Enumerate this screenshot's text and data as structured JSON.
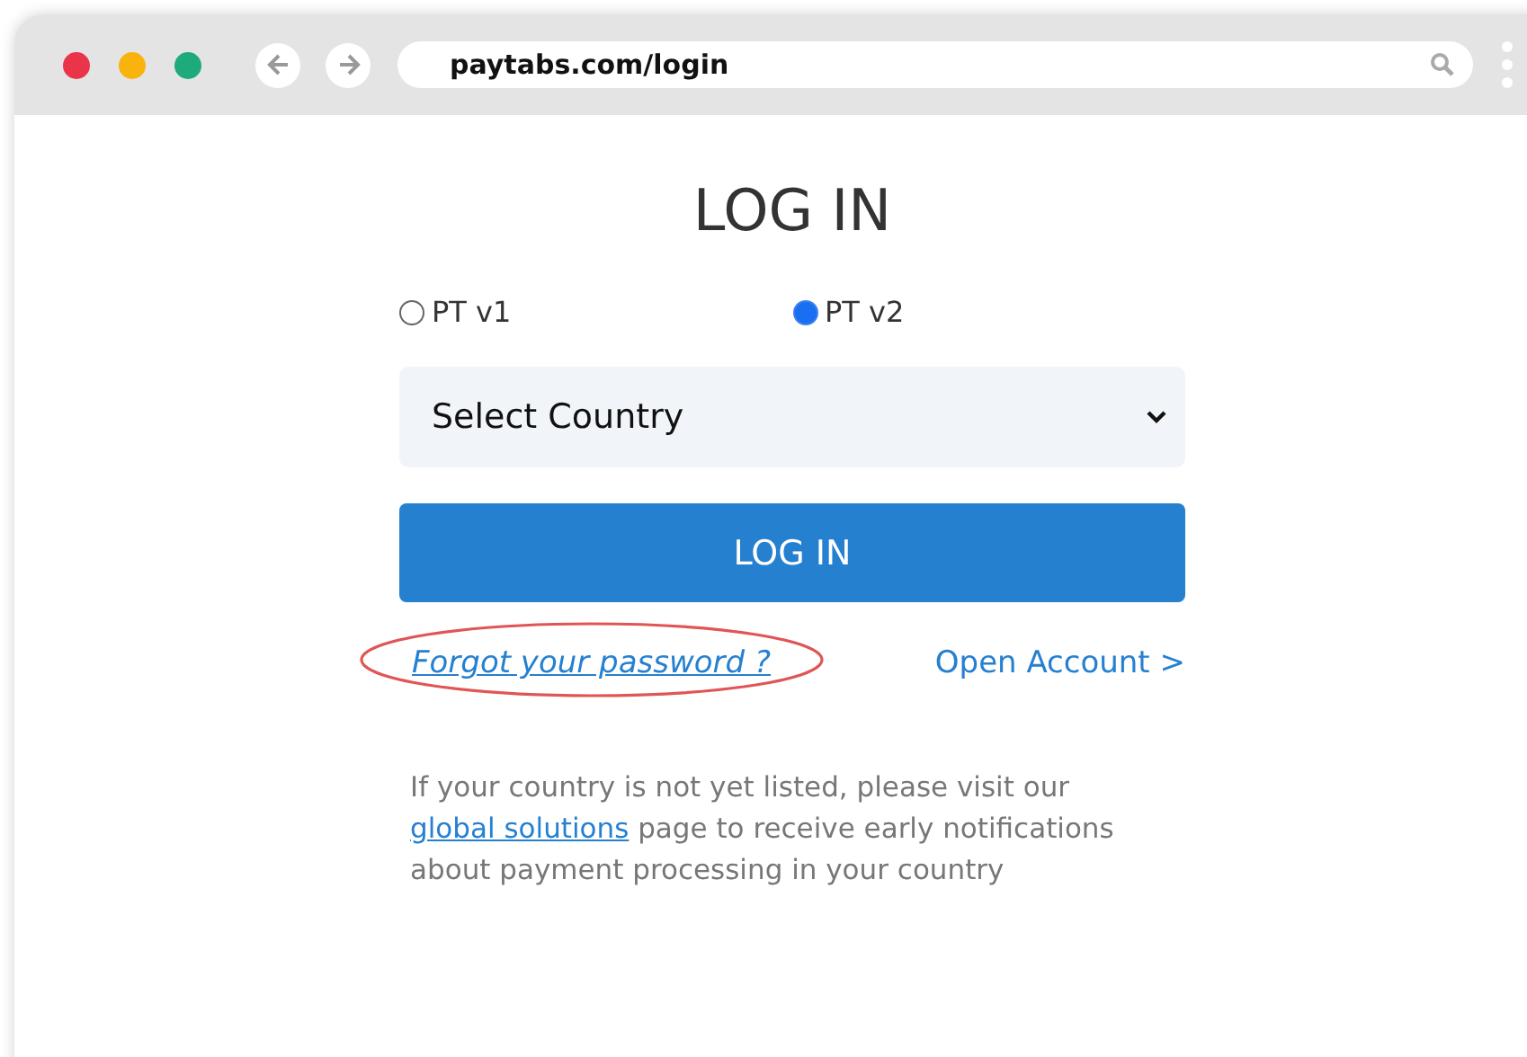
{
  "browser": {
    "url": "paytabs.com/login"
  },
  "title": "LOG IN",
  "versions": [
    {
      "label": "PT v1",
      "selected": false
    },
    {
      "label": "PT v2",
      "selected": true
    }
  ],
  "country_select": {
    "value": "Select Country"
  },
  "login_button": "LOG IN",
  "forgot_link": {
    "label": "Forgot your password ?",
    "circled": true
  },
  "open_account_link": "Open Account >",
  "note": {
    "before": "If your country is not yet listed, please visit our",
    "link": "global solutions",
    "after": "page to receive early notifications about payment processing in your country"
  }
}
